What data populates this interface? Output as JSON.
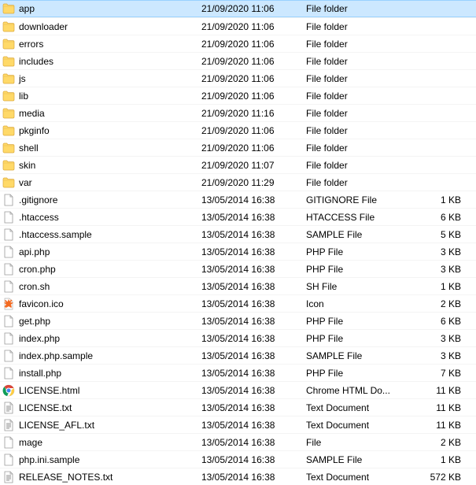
{
  "files": [
    {
      "name": "app",
      "date": "21/09/2020 11:06",
      "type": "File folder",
      "size": "",
      "icon": "folder",
      "selected": true
    },
    {
      "name": "downloader",
      "date": "21/09/2020 11:06",
      "type": "File folder",
      "size": "",
      "icon": "folder"
    },
    {
      "name": "errors",
      "date": "21/09/2020 11:06",
      "type": "File folder",
      "size": "",
      "icon": "folder"
    },
    {
      "name": "includes",
      "date": "21/09/2020 11:06",
      "type": "File folder",
      "size": "",
      "icon": "folder"
    },
    {
      "name": "js",
      "date": "21/09/2020 11:06",
      "type": "File folder",
      "size": "",
      "icon": "folder"
    },
    {
      "name": "lib",
      "date": "21/09/2020 11:06",
      "type": "File folder",
      "size": "",
      "icon": "folder"
    },
    {
      "name": "media",
      "date": "21/09/2020 11:16",
      "type": "File folder",
      "size": "",
      "icon": "folder"
    },
    {
      "name": "pkginfo",
      "date": "21/09/2020 11:06",
      "type": "File folder",
      "size": "",
      "icon": "folder"
    },
    {
      "name": "shell",
      "date": "21/09/2020 11:06",
      "type": "File folder",
      "size": "",
      "icon": "folder"
    },
    {
      "name": "skin",
      "date": "21/09/2020 11:07",
      "type": "File folder",
      "size": "",
      "icon": "folder"
    },
    {
      "name": "var",
      "date": "21/09/2020 11:29",
      "type": "File folder",
      "size": "",
      "icon": "folder"
    },
    {
      "name": ".gitignore",
      "date": "13/05/2014 16:38",
      "type": "GITIGNORE File",
      "size": "1 KB",
      "icon": "file"
    },
    {
      "name": ".htaccess",
      "date": "13/05/2014 16:38",
      "type": "HTACCESS File",
      "size": "6 KB",
      "icon": "file"
    },
    {
      "name": ".htaccess.sample",
      "date": "13/05/2014 16:38",
      "type": "SAMPLE File",
      "size": "5 KB",
      "icon": "file"
    },
    {
      "name": "api.php",
      "date": "13/05/2014 16:38",
      "type": "PHP File",
      "size": "3 KB",
      "icon": "file"
    },
    {
      "name": "cron.php",
      "date": "13/05/2014 16:38",
      "type": "PHP File",
      "size": "3 KB",
      "icon": "file"
    },
    {
      "name": "cron.sh",
      "date": "13/05/2014 16:38",
      "type": "SH File",
      "size": "1 KB",
      "icon": "file"
    },
    {
      "name": "favicon.ico",
      "date": "13/05/2014 16:38",
      "type": "Icon",
      "size": "2 KB",
      "icon": "favicon"
    },
    {
      "name": "get.php",
      "date": "13/05/2014 16:38",
      "type": "PHP File",
      "size": "6 KB",
      "icon": "file"
    },
    {
      "name": "index.php",
      "date": "13/05/2014 16:38",
      "type": "PHP File",
      "size": "3 KB",
      "icon": "file"
    },
    {
      "name": "index.php.sample",
      "date": "13/05/2014 16:38",
      "type": "SAMPLE File",
      "size": "3 KB",
      "icon": "file"
    },
    {
      "name": "install.php",
      "date": "13/05/2014 16:38",
      "type": "PHP File",
      "size": "7 KB",
      "icon": "file"
    },
    {
      "name": "LICENSE.html",
      "date": "13/05/2014 16:38",
      "type": "Chrome HTML Do...",
      "size": "11 KB",
      "icon": "chrome"
    },
    {
      "name": "LICENSE.txt",
      "date": "13/05/2014 16:38",
      "type": "Text Document",
      "size": "11 KB",
      "icon": "text"
    },
    {
      "name": "LICENSE_AFL.txt",
      "date": "13/05/2014 16:38",
      "type": "Text Document",
      "size": "11 KB",
      "icon": "text"
    },
    {
      "name": "mage",
      "date": "13/05/2014 16:38",
      "type": "File",
      "size": "2 KB",
      "icon": "file"
    },
    {
      "name": "php.ini.sample",
      "date": "13/05/2014 16:38",
      "type": "SAMPLE File",
      "size": "1 KB",
      "icon": "file"
    },
    {
      "name": "RELEASE_NOTES.txt",
      "date": "13/05/2014 16:38",
      "type": "Text Document",
      "size": "572 KB",
      "icon": "text"
    }
  ]
}
